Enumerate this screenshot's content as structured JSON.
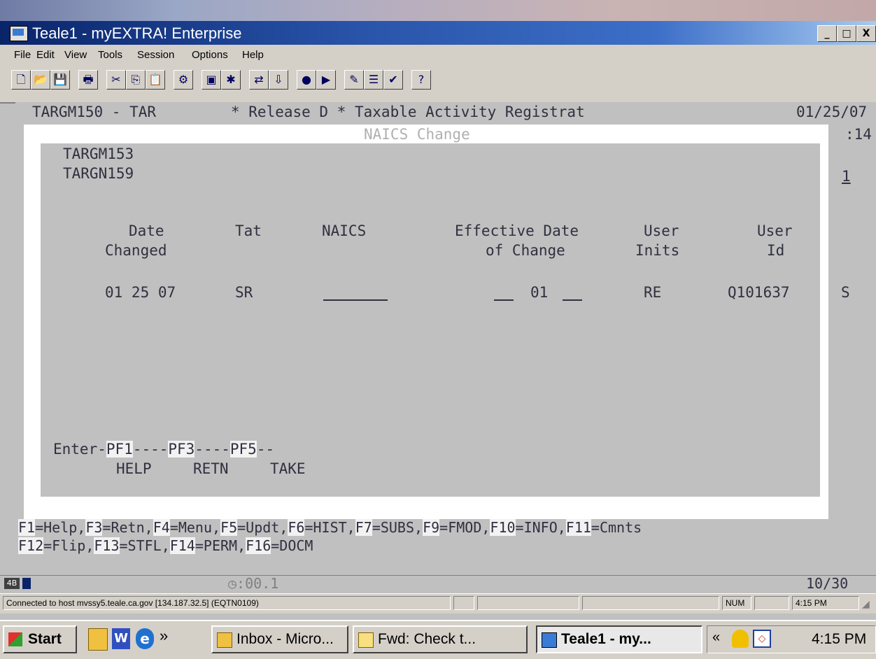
{
  "window": {
    "title": "Teale1 - myEXTRA! Enterprise",
    "controls": [
      "_",
      "□",
      "X"
    ]
  },
  "menu": [
    "File",
    "Edit",
    "View",
    "Tools",
    "Session",
    "Options",
    "Help"
  ],
  "terminal": {
    "header_left": "TARGM150 - TAR",
    "header_center": "* Release D * Taxable Activity Registrat",
    "header_date": "01/25/07",
    "header_time": ":14",
    "dialog_title": "NAICS Change",
    "screen_id_1": "TARGM153",
    "screen_id_2": "TARGN159",
    "page_number": "1",
    "columns": {
      "date_1": "Date",
      "date_2": "Changed",
      "tat": "Tat",
      "naics": "NAICS",
      "eff_1": "Effective Date",
      "eff_2": "of Change",
      "inits_1": "User",
      "inits_2": "Inits",
      "userid_1": "User",
      "userid_2": "Id"
    },
    "row": {
      "date_changed": "01 25 07",
      "tat": "SR",
      "naics": "",
      "eff_month": "",
      "eff_day": "01",
      "eff_year": "",
      "user_inits": "RE",
      "user_id": "Q101637",
      "flag": "S"
    },
    "pf_line": {
      "enter": "Enter-",
      "pf1": "PF1",
      "dash1": "----",
      "pf3": "PF3",
      "dash2": "----",
      "pf5": "PF5",
      "dash3": "--",
      "help": "HELP",
      "retn": "RETN",
      "take": "TAKE"
    },
    "fkeys_line1": [
      {
        "key": "F1",
        "label": "=Help,"
      },
      {
        "key": "F3",
        "label": "=Retn,"
      },
      {
        "key": "F4",
        "label": "=Menu,"
      },
      {
        "key": "F5",
        "label": "=Updt,"
      },
      {
        "key": "F6",
        "label": "=HIST,"
      },
      {
        "key": "F7",
        "label": "=SUBS,"
      },
      {
        "key": "F9",
        "label": "=FMOD,"
      },
      {
        "key": "F10",
        "label": "=INFO,"
      },
      {
        "key": "F11",
        "label": "=Cmnts"
      }
    ],
    "fkeys_line2": [
      {
        "key": "F12",
        "label": "=Flip,"
      },
      {
        "key": "F13",
        "label": "=STFL,"
      },
      {
        "key": "F14",
        "label": "=PERM,"
      },
      {
        "key": "F16",
        "label": "=DOCM"
      }
    ]
  },
  "oia": {
    "indicator": "4B",
    "timer": ":00.1",
    "cursor_pos": "10/30"
  },
  "status": {
    "connection": "Connected to host mvssy5.teale.ca.gov [134.187.32.5] (EQTN0109)",
    "num": "NUM",
    "time": "4:15 PM"
  },
  "taskbar": {
    "start": "Start",
    "chevron": "»",
    "tasks": [
      "Inbox - Micro...",
      "Fwd: Check t...",
      "Teale1 - my..."
    ],
    "tray_chevron": "«",
    "clock": "4:15 PM"
  },
  "colors": {
    "title_blue": "#0a246a",
    "terminal_bg": "#c0c0c0",
    "terminal_text": "#303040",
    "panel_border": "#ffffff"
  }
}
